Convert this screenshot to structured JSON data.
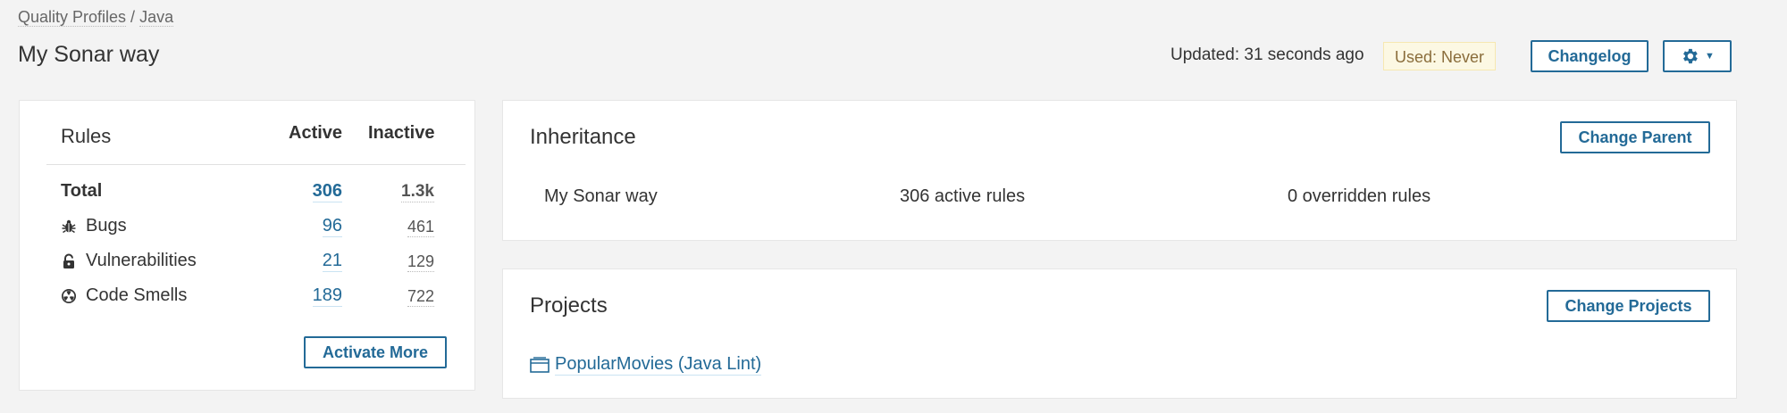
{
  "breadcrumb": {
    "root": "Quality Profiles",
    "separator": " / ",
    "language": "Java"
  },
  "page_title": "My Sonar way",
  "header": {
    "updated": "Updated: 31 seconds ago",
    "used": "Used: Never",
    "changelog_label": "Changelog",
    "gear_icon": "gear-icon"
  },
  "rules": {
    "title": "Rules",
    "col_active": "Active",
    "col_inactive": "Inactive",
    "rows": [
      {
        "label": "Total",
        "active": "306",
        "inactive": "1.3k",
        "icon": ""
      },
      {
        "label": "Bugs",
        "active": "96",
        "inactive": "461",
        "icon": "bug-icon"
      },
      {
        "label": "Vulnerabilities",
        "active": "21",
        "inactive": "129",
        "icon": "lock-icon"
      },
      {
        "label": "Code Smells",
        "active": "189",
        "inactive": "722",
        "icon": "radiation-icon"
      }
    ],
    "activate_more_label": "Activate More"
  },
  "inheritance": {
    "title": "Inheritance",
    "change_parent_label": "Change Parent",
    "profile_name": "My Sonar way",
    "active_rules": "306 active rules",
    "overridden_rules": "0 overridden rules"
  },
  "projects": {
    "title": "Projects",
    "change_projects_label": "Change Projects",
    "items": [
      {
        "name": "PopularMovies (Java Lint)",
        "icon": "project-icon"
      }
    ]
  },
  "colors": {
    "link": "#236a97",
    "badge_bg": "#fcf8e3",
    "badge_text": "#8a6d3b",
    "page_bg": "#f3f3f3"
  }
}
